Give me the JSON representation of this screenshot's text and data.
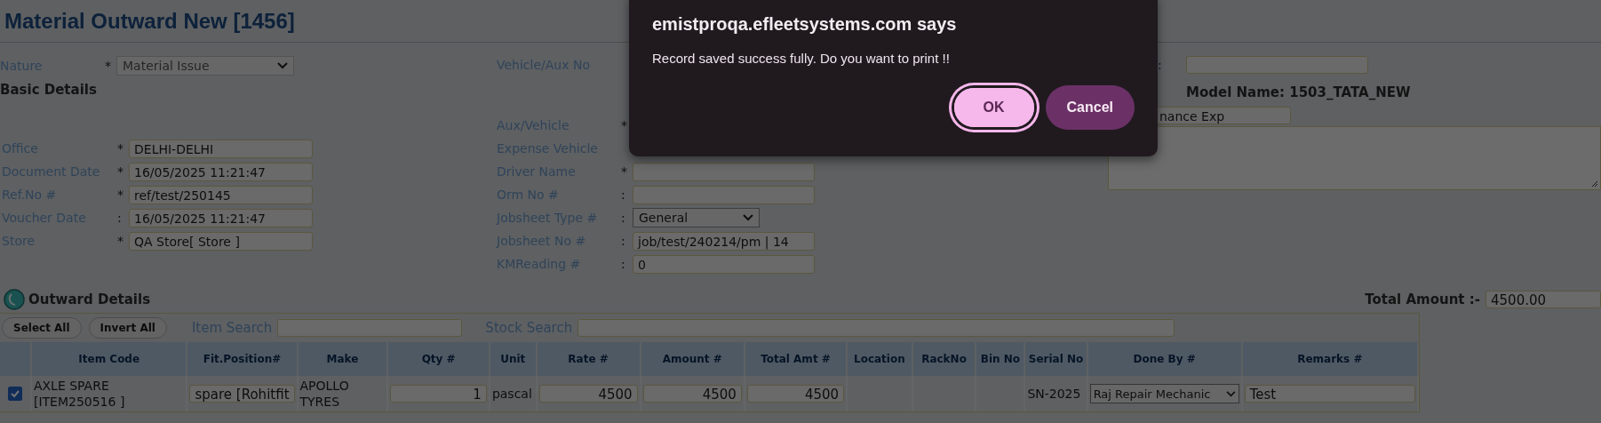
{
  "page_title": "Material Outward New [1456]",
  "left_fields": [
    {
      "kind": "select",
      "label": "Nature",
      "marker": "*",
      "value": "Material Issue"
    },
    {
      "kind": "heading",
      "label": "Basic Details"
    },
    {
      "kind": "spacer"
    },
    {
      "kind": "text",
      "label": "Office",
      "marker": "*",
      "value": "DELHI-DELHI"
    },
    {
      "kind": "text",
      "label": "Document Date",
      "marker": "*",
      "value": "16/05/2025 11:21:47"
    },
    {
      "kind": "text",
      "label": "Ref.No #",
      "marker": "*",
      "value": "ref/test/250145"
    },
    {
      "kind": "text",
      "label": "Voucher Date",
      "marker": ":",
      "value": "16/05/2025 11:21:47"
    },
    {
      "kind": "text",
      "label": "Store",
      "marker": "*",
      "value": "QA Store[ Store ]"
    }
  ],
  "middle_fields": [
    {
      "kind": "label",
      "label": "Vehicle/Aux No"
    },
    {
      "kind": "spacer"
    },
    {
      "kind": "label",
      "label": "Aux/Vehicle",
      "marker": "*"
    },
    {
      "kind": "label",
      "label": "Expense Vehicle"
    },
    {
      "kind": "text",
      "label": "Driver Name",
      "marker": "*"
    },
    {
      "kind": "text",
      "label": "Orm No #",
      "marker": ":"
    },
    {
      "kind": "select",
      "label": "Jobsheet Type #",
      "marker": ":",
      "value": "General"
    },
    {
      "kind": "text",
      "label": "Jobsheet No #",
      "marker": ":",
      "value": "job/test/240214/pm | 14"
    },
    {
      "kind": "text",
      "label": "KMReading #",
      "marker": ":",
      "value": "0"
    }
  ],
  "right_panel": {
    "colon_label": ":",
    "model_name": "Model Name: 1503_TATA_NEW",
    "expense_value": "nance Exp"
  },
  "outward": {
    "title": "Outward Details",
    "total_label": "Total Amount :-",
    "total_value": "4500.00",
    "buttons": [
      "Select All",
      "Invert All"
    ],
    "item_search_label": "Item Search",
    "stock_search_label": "Stock Search"
  },
  "table": {
    "columns": [
      "Item Code",
      "Fit.Position#",
      "Make",
      "Qty #",
      "Unit",
      "Rate #",
      "Amount #",
      "Total Amt #",
      "Location",
      "RackNo",
      "Bin No",
      "Serial No",
      "Done By #",
      "Remarks #"
    ],
    "rows": [
      {
        "checked": true,
        "cells": [
          {
            "kind": "text",
            "value": "AXLE SPARE [ITEM250516 ]"
          },
          {
            "kind": "input",
            "value": "spare [Rohitfit"
          },
          {
            "kind": "text",
            "value": "APOLLO TYRES"
          },
          {
            "kind": "number",
            "value": "1"
          },
          {
            "kind": "text",
            "value": "pascal"
          },
          {
            "kind": "number",
            "value": "4500"
          },
          {
            "kind": "number",
            "value": "4500"
          },
          {
            "kind": "number",
            "value": "4500"
          },
          {
            "kind": "empty"
          },
          {
            "kind": "empty"
          },
          {
            "kind": "empty"
          },
          {
            "kind": "text",
            "value": "SN-2025"
          },
          {
            "kind": "select",
            "value": "Raj Repair Mechanic"
          },
          {
            "kind": "input",
            "value": "Test"
          }
        ]
      }
    ]
  },
  "dialog": {
    "title": "emistproqa.efleetsystems.com says",
    "message": "Record saved success fully. Do you want to print !!",
    "buttons": [
      {
        "label": "OK",
        "focused": true
      },
      {
        "label": "Cancel",
        "focused": false
      }
    ]
  }
}
